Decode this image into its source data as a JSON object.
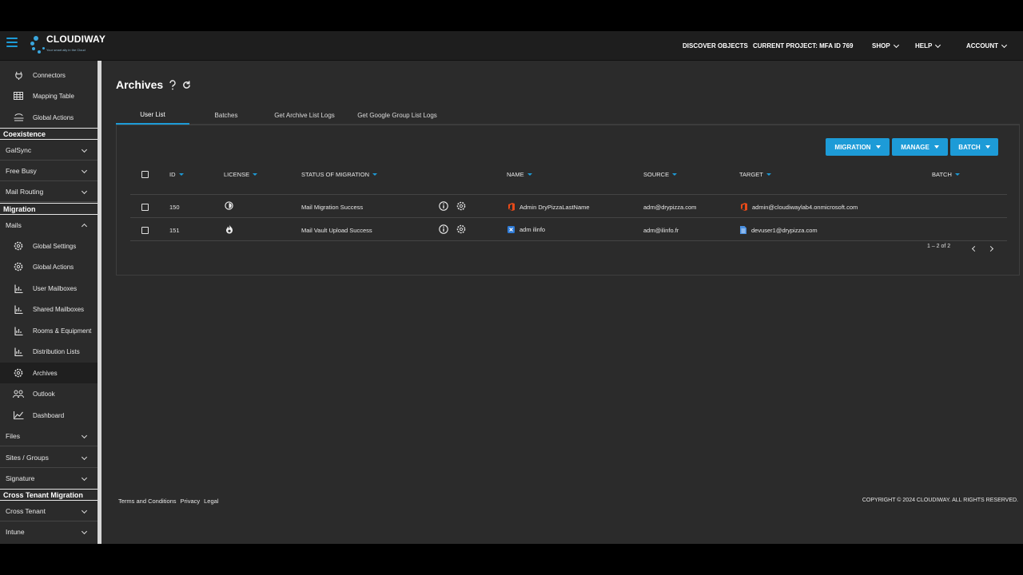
{
  "brand": {
    "name": "CLOUDIWAY",
    "tagline": "Your smart ally in the Cloud",
    "accent": "#1d9bd7"
  },
  "topnav": {
    "discover": "DISCOVER OBJECTS",
    "project": "CURRENT PROJECT: MFA ID 769",
    "shop": "SHOP",
    "help": "HELP",
    "account": "ACCOUNT"
  },
  "sidebar": {
    "top_items": [
      {
        "label": "Connectors",
        "icon": "plug-icon"
      },
      {
        "label": "Mapping Table",
        "icon": "table-icon"
      },
      {
        "label": "Global Actions",
        "icon": "global-actions-icon"
      }
    ],
    "sections": {
      "coexistence": "Coexistence",
      "migration": "Migration",
      "cross_tenant": "Cross Tenant Migration"
    },
    "groups": {
      "galsync": "GalSync",
      "free_busy": "Free Busy",
      "mail_routing": "Mail Routing",
      "mails": "Mails",
      "files": "Files",
      "sites_groups": "Sites / Groups",
      "signature": "Signature",
      "cross_tenant": "Cross Tenant",
      "intune": "Intune"
    },
    "mail_items": [
      {
        "label": "Global Settings",
        "icon": "gear-icon"
      },
      {
        "label": "Global Actions",
        "icon": "gear-icon"
      },
      {
        "label": "User Mailboxes",
        "icon": "mailbox-icon"
      },
      {
        "label": "Shared Mailboxes",
        "icon": "mailbox-icon"
      },
      {
        "label": "Rooms & Equipment",
        "icon": "mailbox-icon"
      },
      {
        "label": "Distribution Lists",
        "icon": "mailbox-icon"
      },
      {
        "label": "Archives",
        "icon": "gear-icon"
      },
      {
        "label": "Outlook",
        "icon": "people-icon"
      },
      {
        "label": "Dashboard",
        "icon": "chart-icon"
      }
    ]
  },
  "page": {
    "title": "Archives"
  },
  "tabs": [
    "User List",
    "Batches",
    "Get Archive List Logs",
    "Get Google Group List Logs"
  ],
  "buttons": {
    "migration": "MIGRATION",
    "manage": "MANAGE",
    "batch": "BATCH"
  },
  "table": {
    "columns": {
      "id": "ID",
      "license": "LICENSE",
      "status": "STATUS OF MIGRATION",
      "name": "NAME",
      "source": "SOURCE",
      "target": "TARGET",
      "batch": "BATCH"
    },
    "rows": [
      {
        "id": "150",
        "status": "Mail Migration Success",
        "name": "Admin DryPizzaLastName",
        "source": "adm@drypizza.com",
        "target": "admin@cloudiwaylab4.onmicrosoft.com",
        "name_icon": "office-icon",
        "target_icon": "office-icon",
        "license_icon": "license-half-icon"
      },
      {
        "id": "151",
        "status": "Mail Vault Upload Success",
        "name": "adm ilinfo",
        "source": "adm@ilinfo.fr",
        "target": "devuser1@drypizza.com",
        "name_icon": "exchange-icon",
        "target_icon": "document-icon",
        "license_icon": "flame-icon"
      }
    ],
    "pagination": "1 – 2 of 2"
  },
  "footer": {
    "terms": "Terms and Conditions",
    "privacy": "Privacy",
    "legal": "Legal",
    "copyright": "COPYRIGHT © 2024 CLOUDIWAY. ALL RIGHTS RESERVED."
  }
}
